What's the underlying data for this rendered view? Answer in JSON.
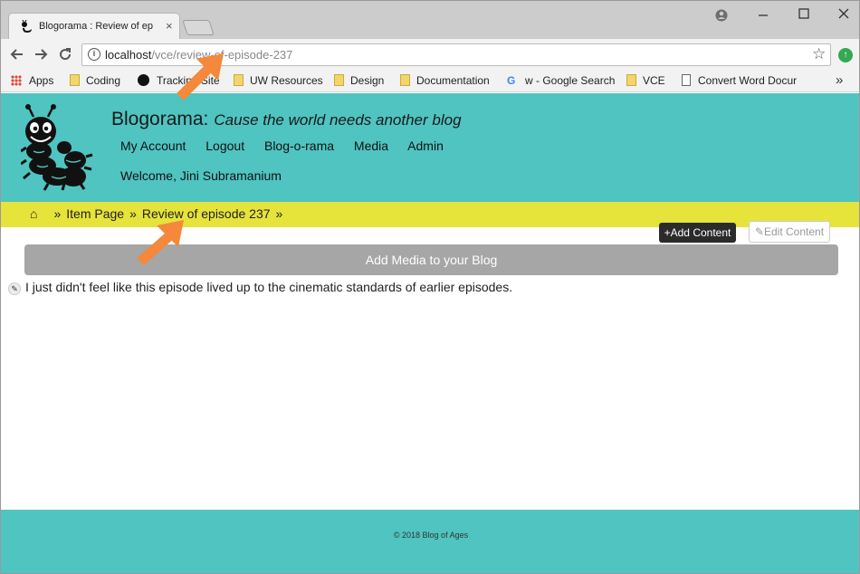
{
  "browser": {
    "tab_title": "Blogorama : Review of ep",
    "tab_close": "×",
    "url_host": "localhost",
    "url_path": "/vce/review-of-episode-237",
    "bookmarks": {
      "apps": "Apps",
      "coding": "Coding",
      "tracking": "Tracking Site",
      "uw": "UW Resources",
      "design": "Design",
      "documentation": "Documentation",
      "google": "w - Google Search",
      "vce": "VCE",
      "convert": "Convert Word Docur"
    },
    "more": "»"
  },
  "site": {
    "name": "Blogorama:",
    "tagline": "Cause the world needs another blog",
    "nav": {
      "account": "My Account",
      "logout": "Logout",
      "blog": "Blog-o-rama",
      "media": "Media",
      "admin": "Admin"
    },
    "welcome": "Welcome, Jini Subramanium"
  },
  "breadcrumb": {
    "home": "⌂",
    "sep": "»",
    "item_page": "Item Page",
    "current": "Review of episode 237"
  },
  "actions": {
    "add_content": "+Add Content",
    "edit_content": "✎Edit Content",
    "add_media": "Add Media to your Blog"
  },
  "content": {
    "text": "I just didn't feel like this episode lived up to the cinematic standards of earlier episodes."
  },
  "footer": {
    "copyright": "© 2018 Blog of Ages"
  },
  "colors": {
    "header": "#4fc4c1",
    "breadcrumb": "#e6e33a",
    "arrow": "#f5883a"
  }
}
